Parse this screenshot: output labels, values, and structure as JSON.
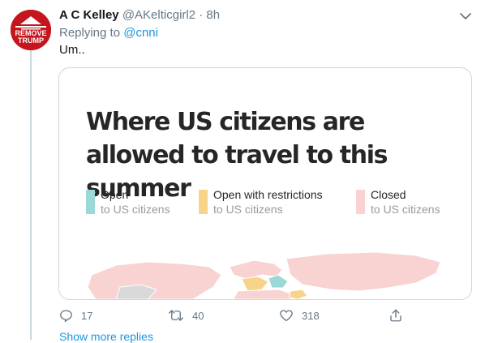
{
  "tweet": {
    "display_name": "A C Kelley",
    "handle": "@AKelticgirl2",
    "separator": "·",
    "time": "8h",
    "replying_label": "Replying to ",
    "replying_to": "@cnni",
    "text": "Um..",
    "avatar_text_line1": "REMOVE",
    "avatar_text_line2": "TRUMP"
  },
  "media": {
    "title": "Where US citizens are allowed to travel to this summer",
    "legend": [
      {
        "label": "Open",
        "sub": "to US citizens",
        "color": "#9ad9d7"
      },
      {
        "label": "Open with restrictions",
        "sub": "to US citizens",
        "color": "#f7d48a"
      },
      {
        "label": "Closed",
        "sub": "to US citizens",
        "color": "#f8d3d1"
      }
    ]
  },
  "actions": {
    "reply_count": "17",
    "retweet_count": "40",
    "like_count": "318"
  },
  "footer": {
    "show_more": "Show more replies"
  },
  "colors": {
    "link": "#1b95e0",
    "secondary_text": "#657786",
    "open": "#9ad9d7",
    "restricted": "#f7d48a",
    "closed": "#f8d3d1"
  }
}
